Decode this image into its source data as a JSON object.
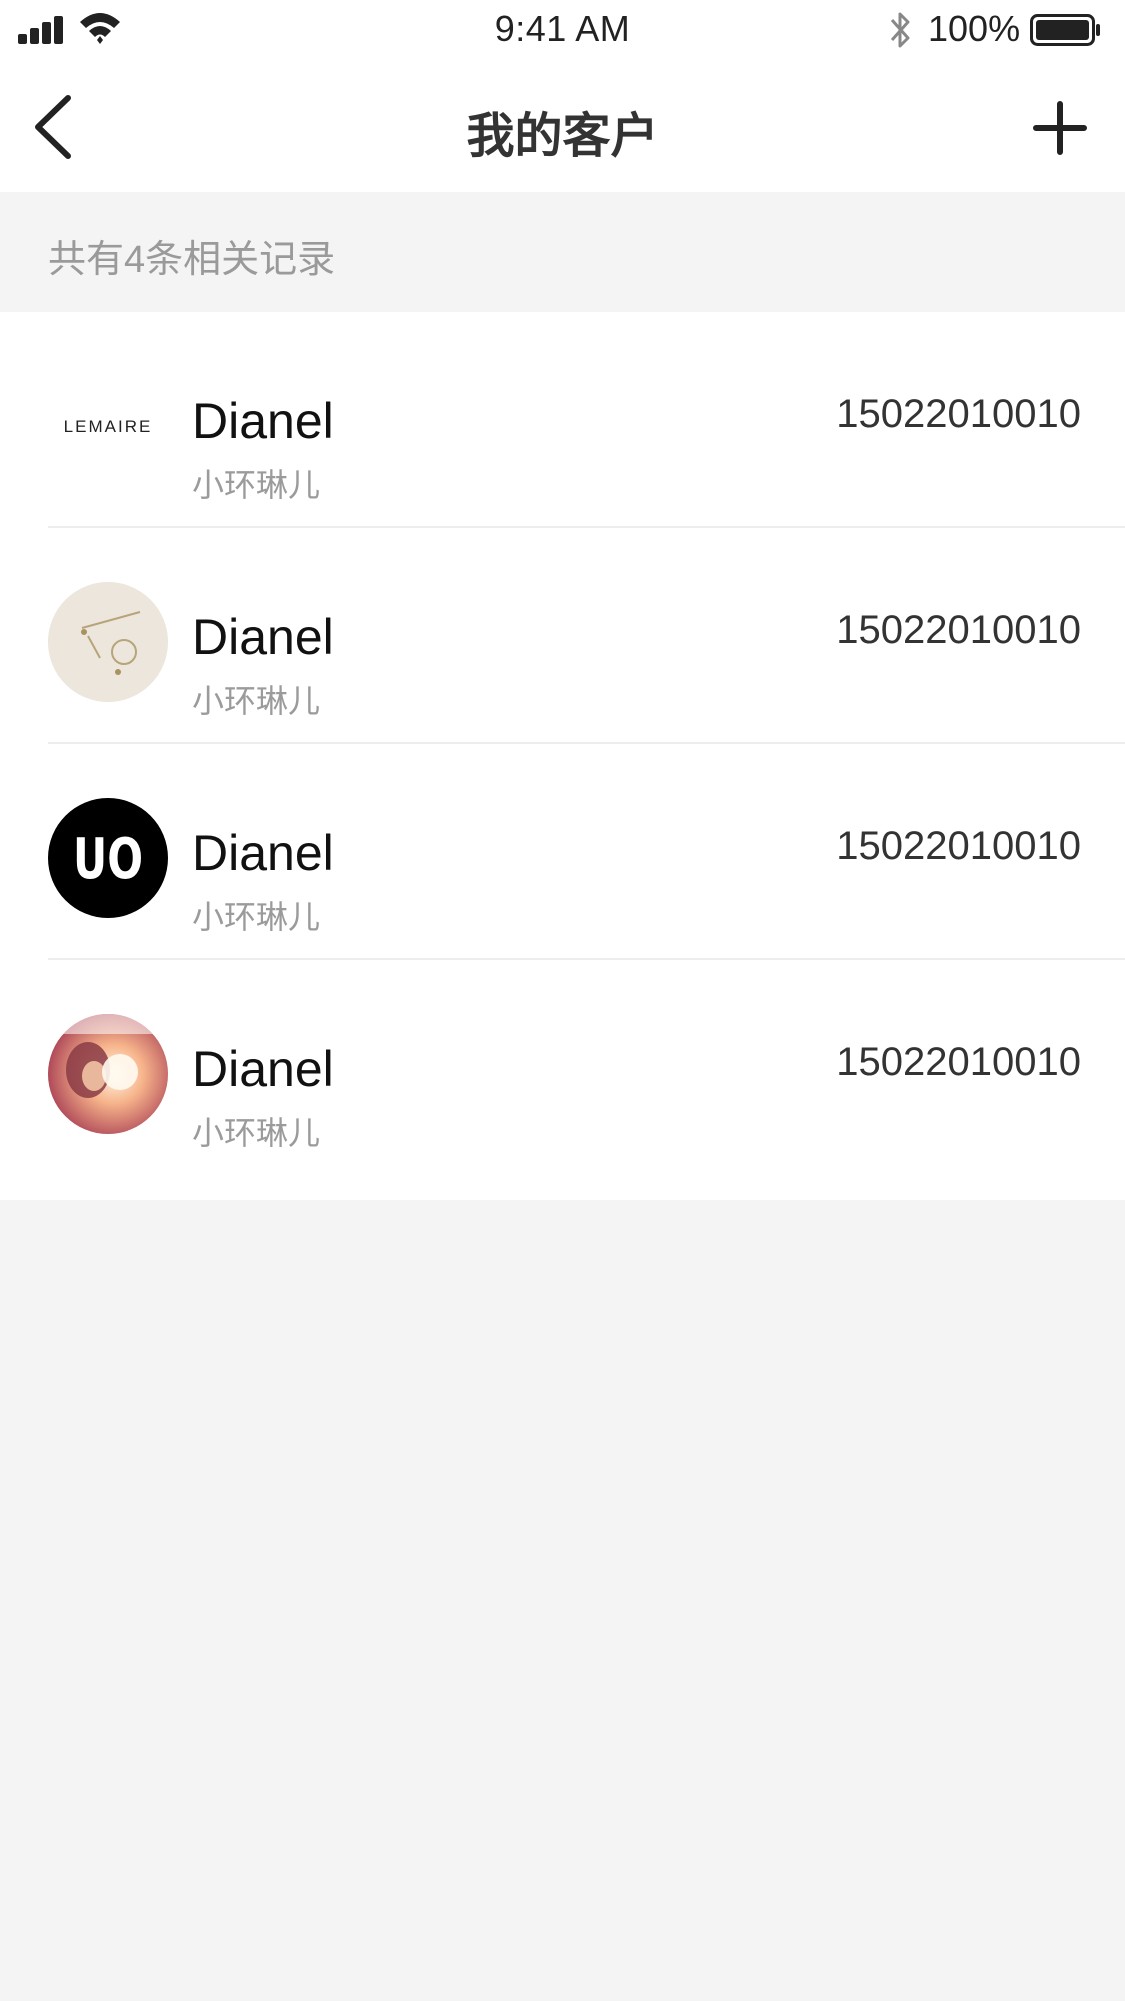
{
  "status_bar": {
    "time": "9:41 AM",
    "battery_percent": "100%",
    "icons": [
      "signal-icon",
      "wifi-icon",
      "bluetooth-icon",
      "battery-icon"
    ]
  },
  "nav": {
    "title": "我的客户",
    "back_icon": "chevron-left-icon",
    "add_icon": "plus-icon"
  },
  "summary": {
    "record_count_text": "共有4条相关记录"
  },
  "customers": [
    {
      "name": "Dianel",
      "nickname": "小环琳儿",
      "phone": "15022010010",
      "avatar": "lemaire-logo",
      "avatar_text": "LEMAIRE"
    },
    {
      "name": "Dianel",
      "nickname": "小环琳儿",
      "phone": "15022010010",
      "avatar": "jewelry-photo"
    },
    {
      "name": "Dianel",
      "nickname": "小环琳儿",
      "phone": "15022010010",
      "avatar": "uo-logo",
      "avatar_text": "UO"
    },
    {
      "name": "Dianel",
      "nickname": "小环琳儿",
      "phone": "15022010010",
      "avatar": "person-photo"
    }
  ],
  "colors": {
    "background": "#f4f4f4",
    "surface": "#ffffff",
    "title_text": "#333333",
    "secondary_text": "#9b9b9b",
    "divider": "#ededed"
  }
}
